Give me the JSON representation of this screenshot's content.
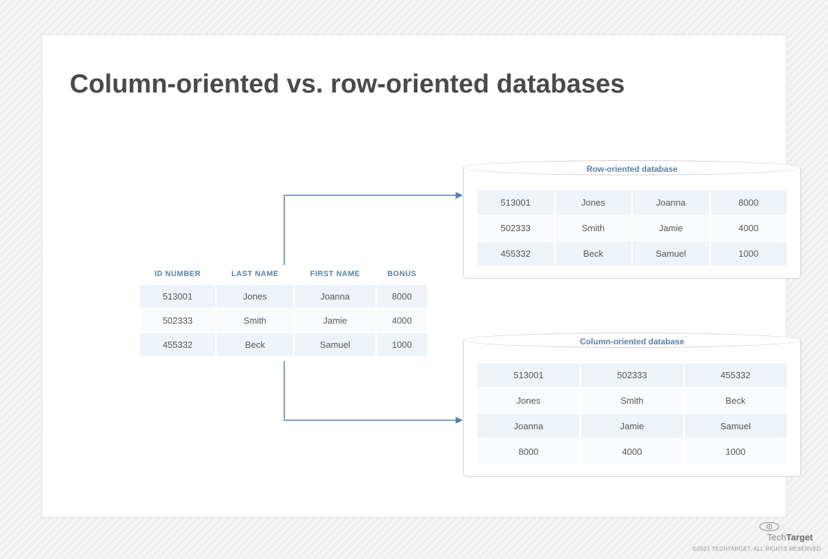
{
  "title": "Column-oriented vs. row-oriented databases",
  "source_table": {
    "headers": [
      "ID NUMBER",
      "LAST NAME",
      "FIRST NAME",
      "BONUS"
    ],
    "rows": [
      [
        "513001",
        "Jones",
        "Joanna",
        "8000"
      ],
      [
        "502333",
        "Smith",
        "Jamie",
        "4000"
      ],
      [
        "455332",
        "Beck",
        "Samuel",
        "1000"
      ]
    ]
  },
  "row_db": {
    "label": "Row-oriented database",
    "rows": [
      [
        "513001",
        "Jones",
        "Joanna",
        "8000"
      ],
      [
        "502333",
        "Smith",
        "Jamie",
        "4000"
      ],
      [
        "455332",
        "Beck",
        "Samuel",
        "1000"
      ]
    ]
  },
  "col_db": {
    "label": "Column-oriented database",
    "rows": [
      [
        "513001",
        "502333",
        "455332"
      ],
      [
        "Jones",
        "Smith",
        "Beck"
      ],
      [
        "Joanna",
        "Jamie",
        "Samuel"
      ],
      [
        "8000",
        "4000",
        "1000"
      ]
    ]
  },
  "copyright": "©2021 TECHTARGET. ALL RIGHTS RESERVED",
  "logo_text_light": "Tech",
  "logo_text_bold": "Target"
}
